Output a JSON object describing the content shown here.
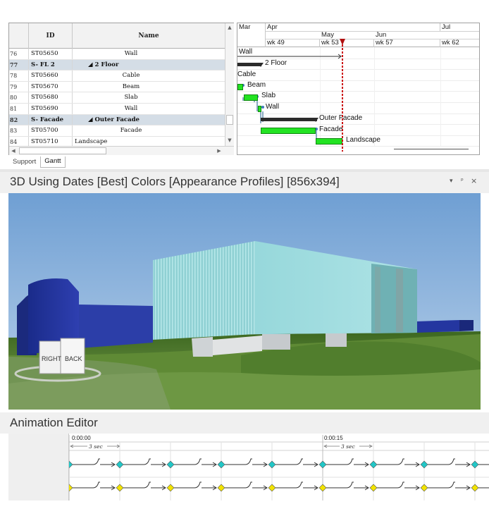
{
  "task_table": {
    "columns": {
      "id": "ID",
      "name": "Name"
    },
    "rows": [
      {
        "num": "76",
        "id": "ST05650",
        "name": "Wall",
        "group": false,
        "style": "center"
      },
      {
        "num": "77",
        "id": "S- FL 2",
        "name": "◢ 2 Floor",
        "group": true,
        "style": "grp"
      },
      {
        "num": "78",
        "id": "ST05660",
        "name": "Cable",
        "group": false,
        "style": "center"
      },
      {
        "num": "79",
        "id": "ST05670",
        "name": "Beam",
        "group": false,
        "style": "center"
      },
      {
        "num": "80",
        "id": "ST05680",
        "name": "Slab",
        "group": false,
        "style": "center"
      },
      {
        "num": "81",
        "id": "ST05690",
        "name": "Wall",
        "group": false,
        "style": "center"
      },
      {
        "num": "82",
        "id": "S- Facade",
        "name": "◢ Outer Facade",
        "group": true,
        "style": "grp"
      },
      {
        "num": "83",
        "id": "ST05700",
        "name": "Facade",
        "group": false,
        "style": "center"
      },
      {
        "num": "84",
        "id": "ST05710",
        "name": "Landscape",
        "group": false,
        "style": "left"
      }
    ]
  },
  "gantt": {
    "months": [
      "Mar",
      "Apr",
      "May",
      "Jun",
      "Jul"
    ],
    "weeks": [
      "wk 49",
      "wk 53",
      "wk 57",
      "wk 62"
    ],
    "labels": {
      "wall_top": "Wall",
      "floor2": "2 Floor",
      "cable": "Cable",
      "beam": "Beam",
      "slab": "Slab",
      "wall": "Wall",
      "outer_facade": "Outer Facade",
      "facade": "Facade",
      "landscape": "Landscape"
    },
    "colors": {
      "task": "#22e322",
      "summary": "#2b2b2b",
      "today": "#cc1111"
    }
  },
  "tabs": [
    "Support",
    "Gantt"
  ],
  "active_tab": "Gantt",
  "viewport": {
    "title": "3D Using Dates [Best] Colors [Appearance Profiles]  [856x394]",
    "controls": {
      "dropdown": "▾",
      "pin": "ᵖ",
      "close": "×"
    },
    "view_cube": {
      "right": "RIGHT",
      "back": "BACK"
    }
  },
  "animation_editor": {
    "title": "Animation Editor",
    "timecodes": [
      "0:00:00",
      "0:00:15"
    ],
    "durations": [
      "3 sec",
      "3 sec"
    ],
    "track_colors": [
      "#22c7c7",
      "#f2e300"
    ]
  }
}
